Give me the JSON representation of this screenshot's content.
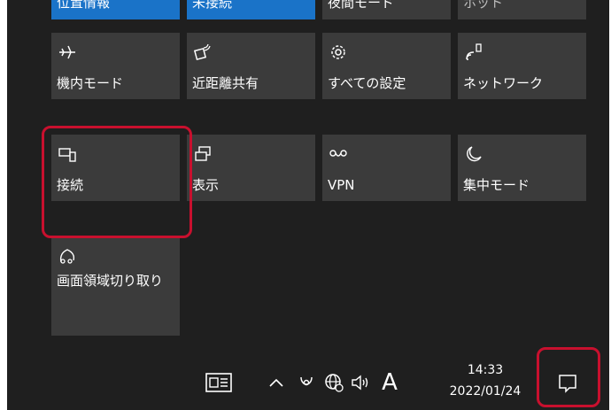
{
  "top_row": [
    {
      "label": "位置情報",
      "active": true
    },
    {
      "label": "未接続",
      "active": true
    },
    {
      "label": "夜間モード",
      "active": false
    },
    {
      "label": "ホット",
      "active": false
    }
  ],
  "tiles": [
    {
      "label": "機内モード",
      "icon": "airplane-icon"
    },
    {
      "label": "近距離共有",
      "icon": "nearby-share-icon"
    },
    {
      "label": "すべての設定",
      "icon": "gear-icon"
    },
    {
      "label": "ネットワーク",
      "icon": "network-icon"
    },
    {
      "label": "接続",
      "icon": "connect-icon"
    },
    {
      "label": "表示",
      "icon": "project-icon"
    },
    {
      "label": "VPN",
      "icon": "vpn-icon"
    },
    {
      "label": "集中モード",
      "icon": "moon-icon"
    },
    {
      "label": "画面領域切り取り",
      "icon": "snip-icon"
    }
  ],
  "taskbar": {
    "ime_label": "A",
    "time": "14:33",
    "date": "2022/01/24"
  },
  "colors": {
    "panel_bg": "#1f1f1f",
    "tile_bg": "#3b3b3b",
    "tile_active": "#1a73c8",
    "highlight": "#c8102e"
  }
}
